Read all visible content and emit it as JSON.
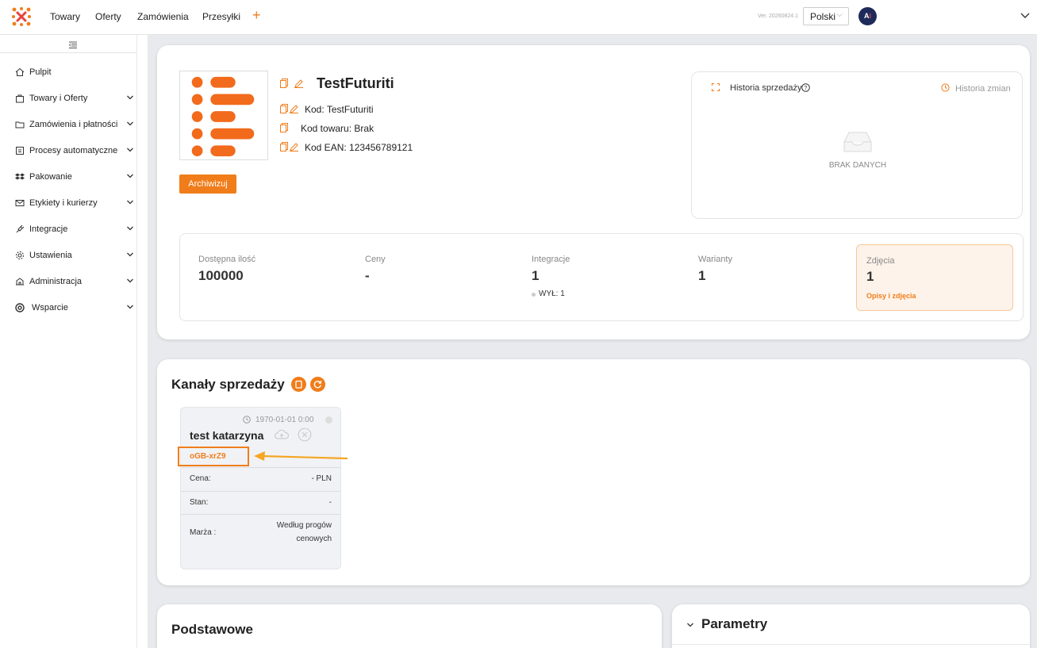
{
  "nav": {
    "items": [
      "Towary",
      "Oferty",
      "Zamówienia",
      "Przesyłki"
    ],
    "plus": "+",
    "version": "Ver. 20260824.1",
    "language": "Polski",
    "avatar_text": "A",
    "avatar_accent": "i"
  },
  "sidebar": {
    "items": [
      {
        "label": "Pulpit",
        "icon": "home-icon",
        "has_arrow": false
      },
      {
        "label": "Towary i Oferty",
        "icon": "bag-icon",
        "has_arrow": true
      },
      {
        "label": "Zamówienia i płatności",
        "icon": "folder-icon",
        "has_arrow": true
      },
      {
        "label": "Procesy automatyczne",
        "icon": "process-icon",
        "has_arrow": true
      },
      {
        "label": "Pakowanie",
        "icon": "dropbox-icon",
        "has_arrow": true
      },
      {
        "label": "Etykiety i kurierzy",
        "icon": "mail-icon",
        "has_arrow": true
      },
      {
        "label": "Integracje",
        "icon": "plug-icon",
        "has_arrow": true
      },
      {
        "label": "Ustawienia",
        "icon": "gear-icon",
        "has_arrow": true
      },
      {
        "label": "Administracja",
        "icon": "admin-icon",
        "has_arrow": true
      },
      {
        "label": "Wsparcie",
        "icon": "lifebuoy-icon",
        "has_arrow": true
      }
    ]
  },
  "product": {
    "name": "TestFuturiti",
    "code_label": "Kod:",
    "code_value": "TestFuturiti",
    "sku_label": "Kod towaru:",
    "sku_value": "Brak",
    "ean_label": "Kod EAN:",
    "ean_value": "123456789121",
    "archive_button": "Archiwizuj"
  },
  "history": {
    "title": "Historia sprzedaży",
    "changes": "Historia zmian",
    "empty": "BRAK DANYCH"
  },
  "stats": {
    "available_label": "Dostępna ilość",
    "available_value": "100000",
    "prices_label": "Ceny",
    "prices_value": "-",
    "integrations_label": "Integracje",
    "integrations_value": "1",
    "integrations_sub": "WYŁ: 1",
    "variants_label": "Warianty",
    "variants_value": "1",
    "photos_label": "Zdjęcia",
    "photos_value": "1",
    "photos_link": "Opisy i zdjęcia"
  },
  "channels": {
    "title": "Kanały sprzedaży",
    "card": {
      "date": "1970-01-01 0:00",
      "name": "test katarzyna",
      "code": "oGB-xrZ9",
      "price_label": "Cena:",
      "price_value": "- PLN",
      "stock_label": "Stan:",
      "stock_value": "-",
      "margin_label": "Marża :",
      "margin_value_line1": "Według progów",
      "margin_value_line2": "cenowych"
    }
  },
  "sections": {
    "basic": "Podstawowe",
    "params": "Parametry"
  },
  "colors": {
    "accent": "#f07d1a",
    "arrow": "#f5a623"
  }
}
